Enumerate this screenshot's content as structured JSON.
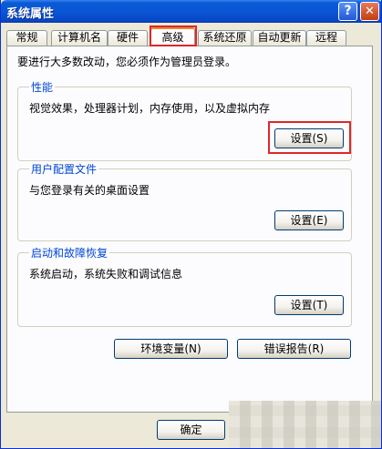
{
  "window": {
    "title": "系统属性",
    "help_label": "?",
    "close_label": "✕"
  },
  "tabs": [
    {
      "label": "常规",
      "active": false
    },
    {
      "label": "计算机名",
      "active": false
    },
    {
      "label": "硬件",
      "active": false
    },
    {
      "label": "高级",
      "active": true
    },
    {
      "label": "系统还原",
      "active": false
    },
    {
      "label": "自动更新",
      "active": false
    },
    {
      "label": "远程",
      "active": false
    }
  ],
  "intro": "要进行大多数改动，您必须作为管理员登录。",
  "groups": {
    "performance": {
      "title": "性能",
      "desc": "视觉效果，处理器计划，内存使用，以及虚拟内存",
      "button": "设置(S)"
    },
    "profiles": {
      "title": "用户配置文件",
      "desc": "与您登录有关的桌面设置",
      "button": "设置(E)"
    },
    "startup": {
      "title": "启动和故障恢复",
      "desc": "系统启动，系统失败和调试信息",
      "button": "设置(T)"
    }
  },
  "buttons": {
    "env_vars": "环境变量(N)",
    "error_report": "错误报告(R)",
    "ok": "确定"
  },
  "colors": {
    "titlebar": "#0a56d4",
    "highlight": "#e0262a",
    "group_title": "#0046d5"
  }
}
